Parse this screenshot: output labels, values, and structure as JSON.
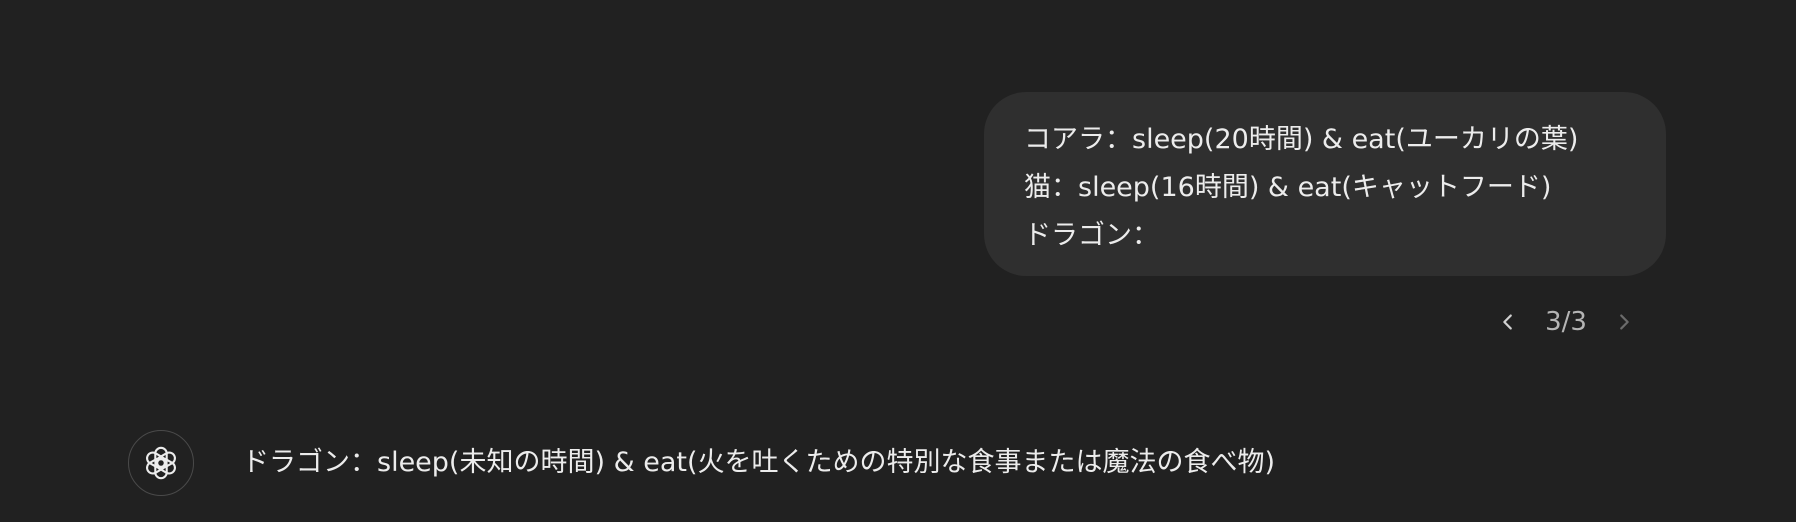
{
  "conversation": {
    "user_message": {
      "lines": [
        "コアラ：sleep(20時間) & eat(ユーカリの葉)",
        "猫：sleep(16時間) & eat(キャットフード)",
        "ドラゴン："
      ]
    },
    "pager": {
      "count": "3/3",
      "prev_icon": "chevron-left-icon",
      "next_icon": "chevron-right-icon"
    },
    "assistant_message": {
      "avatar_icon": "openai-logo-icon",
      "text": "ドラゴン：sleep(未知の時間) & eat(火を吐くための特別な食事または魔法の食べ物)"
    }
  },
  "colors": {
    "background": "#212121",
    "bubble": "#2f2f2f",
    "text": "#ececec",
    "muted": "#b4b4b4",
    "disabled": "#6b6b6b"
  }
}
